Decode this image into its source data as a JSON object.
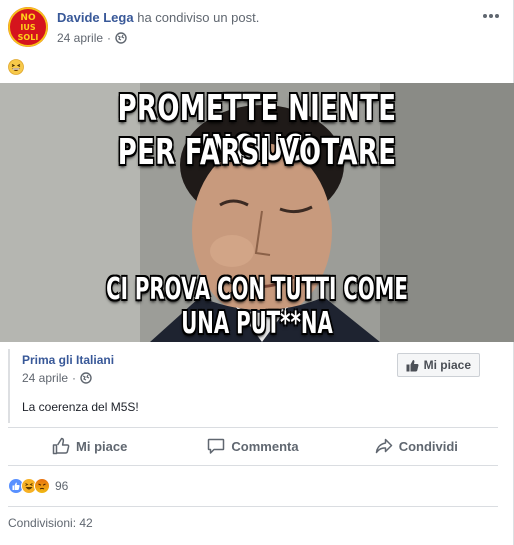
{
  "post": {
    "author": "Davide Lega",
    "action": "ha condiviso un post.",
    "date": "24 aprile",
    "audience_icon": "globe-icon",
    "text_emoji": "grinning-squinting-face-emoji",
    "avatar_text": [
      "NO",
      "IUS",
      "SOLI"
    ]
  },
  "meme": {
    "line1": "PROMETTE NIENTE INCIUCI",
    "line2": "PER FARSI VOTARE",
    "line3": "CI PROVA CON TUTTI COME UNA PUT**NA"
  },
  "shared": {
    "page_name": "Prima gli Italiani",
    "date": "24 aprile",
    "like_button": "Mi piace",
    "text": "La coerenza del M5S!"
  },
  "actions": {
    "like": "Mi piace",
    "comment": "Commenta",
    "share": "Condividi"
  },
  "stats": {
    "reaction_types": [
      "like",
      "haha",
      "angry"
    ],
    "reaction_count": "96",
    "shares": "Condivisioni: 42"
  },
  "colors": {
    "link": "#385898",
    "secondary_text": "#606770",
    "like_reaction": "#5890ff",
    "haha_reaction": "#f7b125"
  }
}
